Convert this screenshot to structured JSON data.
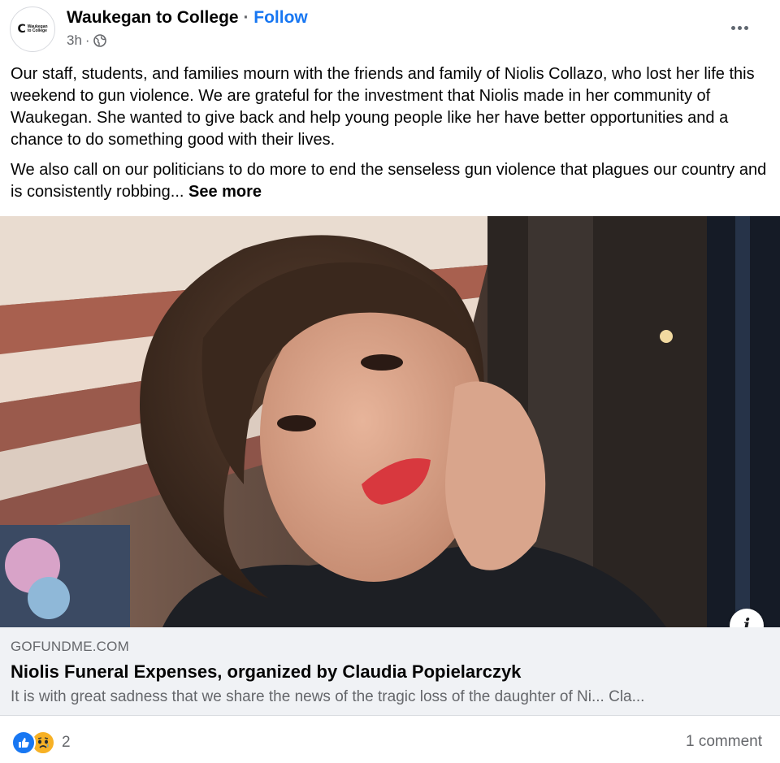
{
  "header": {
    "page_name": "Waukegan to College",
    "separator": "·",
    "follow_label": "Follow",
    "time": "3h",
    "time_separator": "·",
    "privacy_icon": "globe-icon",
    "more_icon": "more-horizontal-icon",
    "avatar_logo": {
      "mark": "C",
      "line1": "Waukegan",
      "line2": "to College"
    }
  },
  "post": {
    "paragraph1": "Our staff, students, and families mourn with the friends and family of Niolis Collazo, who lost her life this weekend to gun violence. We are grateful for the investment that Niolis made in her community of Waukegan. She wanted to give back and help young people like her have better opportunities and a chance to do something good with their lives.",
    "paragraph2": "We also call on our politicians to do more to end the senseless gun violence that plagues our country and is consistently robbing...",
    "see_more_label": "See more"
  },
  "link_preview": {
    "info_icon": "info-icon",
    "info_label": "i",
    "domain": "GOFUNDME.COM",
    "title": "Niolis Funeral Expenses, organized by Claudia Popielarczyk",
    "description": "It is with great sadness that we share the news of the tragic loss of the daughter of Ni... Cla..."
  },
  "footer": {
    "reaction_icons": [
      "like-icon",
      "sad-icon"
    ],
    "reaction_count": "2",
    "comment_count": "1 comment"
  },
  "colors": {
    "accent": "#1877f2",
    "secondary_text": "#65676b",
    "card_background": "#f0f2f5",
    "sad_reaction": "#f7b125"
  }
}
